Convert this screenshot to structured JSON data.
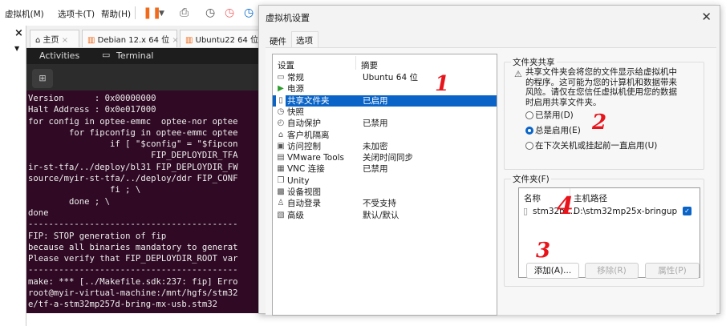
{
  "menubar": {
    "items": [
      "虚拟机(M)",
      "选项卡(T)",
      "帮助(H)"
    ]
  },
  "vm_tabs": [
    {
      "label": "主页"
    },
    {
      "label": "Debian 12.x 64 位"
    },
    {
      "label": "Ubuntu22 64 位"
    }
  ],
  "gnome": {
    "activities": "Activities",
    "app": "Terminal"
  },
  "terminal_lines": [
    "Version      : 0x00000000",
    "Halt Address : 0x0e017000",
    "for config in optee-emmc  optee-nor optee",
    "        for fipconfig in optee-emmc optee",
    "                if [ \"$config\" = \"$fipcon",
    "                        FIP_DEPLOYDIR_TFA",
    "ir-st-tfa/../deploy/bl31 FIP_DEPLOYDIR_FW",
    "source/myir-st-tfa/../deploy/ddr FIP_CONF",
    "                fi ; \\",
    "        done ; \\",
    "done",
    "-----------------------------------------",
    "FIP: STOP generation of fip",
    "because all binaries mandatory to generat",
    "Please verify that FIP_DEPLOYDIR_ROOT var",
    "-----------------------------------------",
    "make: *** [../Makefile.sdk:237: fip] Erro",
    "root@myir-virtual-machine:/mnt/hgfs/stm32",
    "e/tf-a-stm32mp257d-bring-mx-usb.stm32"
  ],
  "dialog": {
    "title": "虚拟机设置",
    "tabs": [
      "硬件",
      "选项"
    ],
    "list_headers": {
      "setting": "设置",
      "summary": "摘要"
    },
    "settings": [
      {
        "icon": "monitor-icon",
        "name": "常规",
        "summary": "Ubuntu 64 位"
      },
      {
        "icon": "play-icon",
        "name": "电源",
        "summary": ""
      },
      {
        "icon": "shared-folder-icon",
        "name": "共享文件夹",
        "summary": "已启用",
        "selected": true
      },
      {
        "icon": "snapshot-icon",
        "name": "快照",
        "summary": ""
      },
      {
        "icon": "clock-icon",
        "name": "自动保护",
        "summary": "已禁用"
      },
      {
        "icon": "lock-icon",
        "name": "客户机隔离",
        "summary": ""
      },
      {
        "icon": "access-control-icon",
        "name": "访问控制",
        "summary": "未加密"
      },
      {
        "icon": "vm-icon",
        "name": "VMware Tools",
        "summary": "关闭时间同步"
      },
      {
        "icon": "vnc-icon",
        "name": "VNC 连接",
        "summary": "已禁用"
      },
      {
        "icon": "unity-icon",
        "name": "Unity",
        "summary": ""
      },
      {
        "icon": "device-view-icon",
        "name": "设备视图",
        "summary": ""
      },
      {
        "icon": "user-icon",
        "name": "自动登录",
        "summary": "不受支持"
      },
      {
        "icon": "advanced-icon",
        "name": "高级",
        "summary": "默认/默认"
      }
    ],
    "sharing": {
      "group_label": "文件夹共享",
      "warning": "共享文件夹会将您的文件显示给虚拟机中的程序。这可能为您的计算机和数据带来风险。请仅在您信任虚拟机使用您的数据时启用共享文件夹。",
      "options": [
        {
          "label": "已禁用(D)",
          "checked": false
        },
        {
          "label": "总是启用(E)",
          "checked": true
        },
        {
          "label": "在下次关机或挂起前一直启用(U)",
          "checked": false
        }
      ]
    },
    "folders": {
      "group_label": "文件夹(F)",
      "headers": {
        "name": "名称",
        "path": "主机路径"
      },
      "rows": [
        {
          "name": "stm32m...",
          "path": "D:\\stm32mp25x-bringup",
          "enabled": true
        }
      ],
      "buttons": {
        "add": "添加(A)...",
        "remove": "移除(R)",
        "properties": "属性(P)"
      }
    }
  },
  "annotations": [
    "1",
    "2",
    "3",
    "4"
  ],
  "colors": {
    "selection": "#0a64c8",
    "terminal_bg": "#300a24",
    "annotation": "#e8141b",
    "pause": "#f06a1a"
  }
}
